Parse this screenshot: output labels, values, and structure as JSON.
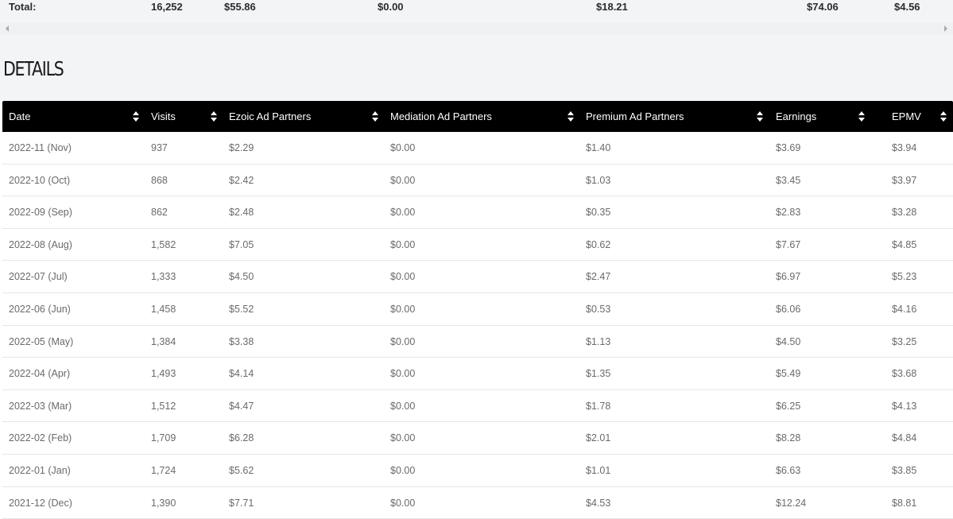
{
  "totals": {
    "label": "Total:",
    "visits": "16,252",
    "ezoic": "$55.86",
    "mediation": "$0.00",
    "premium": "$18.21",
    "earnings": "$74.06",
    "epmv": "$4.56"
  },
  "section_title": "DETAILS",
  "table": {
    "columns": [
      "Date",
      "Visits",
      "Ezoic Ad Partners",
      "Mediation Ad Partners",
      "Premium Ad Partners",
      "Earnings",
      "EPMV"
    ],
    "rows": [
      [
        "2022-11 (Nov)",
        "937",
        "$2.29",
        "$0.00",
        "$1.40",
        "$3.69",
        "$3.94"
      ],
      [
        "2022-10 (Oct)",
        "868",
        "$2.42",
        "$0.00",
        "$1.03",
        "$3.45",
        "$3.97"
      ],
      [
        "2022-09 (Sep)",
        "862",
        "$2.48",
        "$0.00",
        "$0.35",
        "$2.83",
        "$3.28"
      ],
      [
        "2022-08 (Aug)",
        "1,582",
        "$7.05",
        "$0.00",
        "$0.62",
        "$7.67",
        "$4.85"
      ],
      [
        "2022-07 (Jul)",
        "1,333",
        "$4.50",
        "$0.00",
        "$2.47",
        "$6.97",
        "$5.23"
      ],
      [
        "2022-06 (Jun)",
        "1,458",
        "$5.52",
        "$0.00",
        "$0.53",
        "$6.06",
        "$4.16"
      ],
      [
        "2022-05 (May)",
        "1,384",
        "$3.38",
        "$0.00",
        "$1.13",
        "$4.50",
        "$3.25"
      ],
      [
        "2022-04 (Apr)",
        "1,493",
        "$4.14",
        "$0.00",
        "$1.35",
        "$5.49",
        "$3.68"
      ],
      [
        "2022-03 (Mar)",
        "1,512",
        "$4.47",
        "$0.00",
        "$1.78",
        "$6.25",
        "$4.13"
      ],
      [
        "2022-02 (Feb)",
        "1,709",
        "$6.28",
        "$0.00",
        "$2.01",
        "$8.28",
        "$4.84"
      ],
      [
        "2022-01 (Jan)",
        "1,724",
        "$5.62",
        "$0.00",
        "$1.01",
        "$6.63",
        "$3.85"
      ],
      [
        "2021-12 (Dec)",
        "1,390",
        "$7.71",
        "$0.00",
        "$4.53",
        "$12.24",
        "$8.81"
      ]
    ]
  },
  "icons": {
    "sort": "sort-up-down-icon",
    "scroll_left": "chevron-left-icon",
    "scroll_right": "chevron-right-icon"
  },
  "colors": {
    "header_bg": "#000000",
    "page_bg": "#f3f4f6"
  }
}
